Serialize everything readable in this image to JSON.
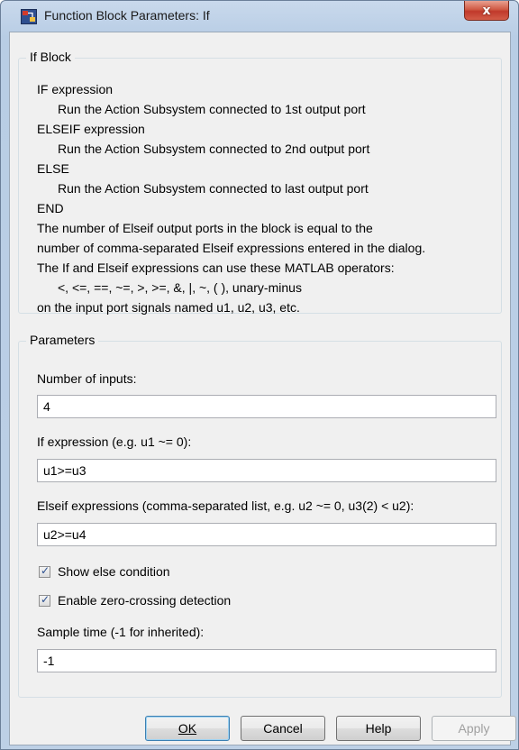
{
  "window": {
    "title": "Function Block Parameters: If",
    "close_label": "x"
  },
  "description": {
    "group_label": "If Block",
    "lines": [
      "IF expression",
      "Run the Action Subsystem connected to 1st output port",
      "ELSEIF expression",
      "Run the Action Subsystem connected to 2nd output port",
      "ELSE",
      "Run the Action Subsystem connected to last output port",
      "END",
      "The number of Elseif output ports in the block is equal to the",
      "number of comma-separated Elseif expressions entered in the dialog.",
      "The If and Elseif expressions can use these MATLAB operators:",
      "<, <=, ==, ~=, >, >=, &, |, ~, ( ), unary-minus",
      "on the input port signals named u1, u2, u3, etc."
    ]
  },
  "parameters": {
    "group_label": "Parameters",
    "num_inputs": {
      "label": "Number of inputs:",
      "value": "4"
    },
    "if_expression": {
      "label": "If expression (e.g. u1 ~= 0):",
      "value": "u1>=u3"
    },
    "elseif_expressions": {
      "label": "Elseif expressions (comma-separated list, e.g. u2 ~= 0, u3(2) < u2):",
      "value": "u2>=u4"
    },
    "show_else": {
      "label": "Show else condition",
      "checked": true
    },
    "zero_crossing": {
      "label": "Enable zero-crossing detection",
      "checked": true
    },
    "sample_time": {
      "label": "Sample time (-1 for inherited):",
      "value": "-1"
    }
  },
  "buttons": {
    "ok": "OK",
    "cancel": "Cancel",
    "help": "Help",
    "apply": "Apply"
  },
  "icons": {
    "app": "simulink-block-icon",
    "check": "checkmark-icon"
  }
}
